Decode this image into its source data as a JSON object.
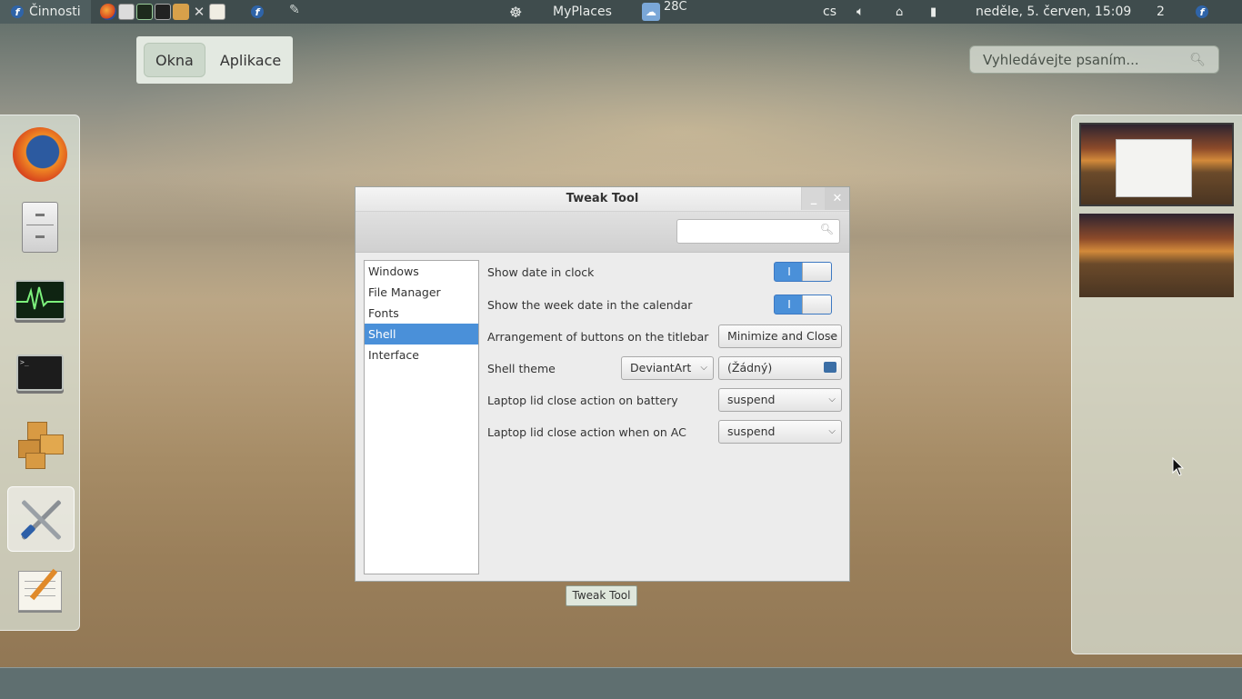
{
  "topbar": {
    "activities_label": "Činnosti",
    "places_label": "MyPlaces",
    "weather_temp": "28C",
    "keyboard_layout": "cs",
    "clock": "neděle,  5. červen, 15:09",
    "workspace_number": "2"
  },
  "overview": {
    "view_tabs": [
      "Okna",
      "Aplikace"
    ],
    "active_tab": "Okna",
    "search_placeholder": "Vyhledávejte psaním..."
  },
  "dash": {
    "apps": [
      "firefox-icon",
      "file-cabinet-icon",
      "system-monitor-icon",
      "terminal-icon",
      "packages-icon",
      "tweak-tool-icon",
      "text-editor-icon"
    ],
    "running_app": "tweak-tool-icon"
  },
  "window": {
    "title": "Tweak Tool",
    "caption": "Tweak Tool",
    "sidebar": [
      "Windows",
      "File Manager",
      "Fonts",
      "Shell",
      "Interface"
    ],
    "selected": "Shell",
    "settings": {
      "show_date": {
        "label": "Show date in clock",
        "state": "on"
      },
      "show_week": {
        "label": "Show the week date in the calendar",
        "state": "on"
      },
      "buttons": {
        "label": "Arrangement of buttons on the titlebar",
        "value": "Minimize and Close"
      },
      "shell_theme": {
        "label": "Shell theme",
        "value": "DeviantArt",
        "file_value": "(Žádný)"
      },
      "lid_battery": {
        "label": "Laptop lid close action on battery",
        "value": "suspend"
      },
      "lid_ac": {
        "label": "Laptop lid close action when on AC",
        "value": "suspend"
      }
    },
    "switch_on_text": "I"
  },
  "colors": {
    "topbar": "#3f4c4d",
    "selection": "#4a90d9",
    "panel": "#dce4da"
  }
}
